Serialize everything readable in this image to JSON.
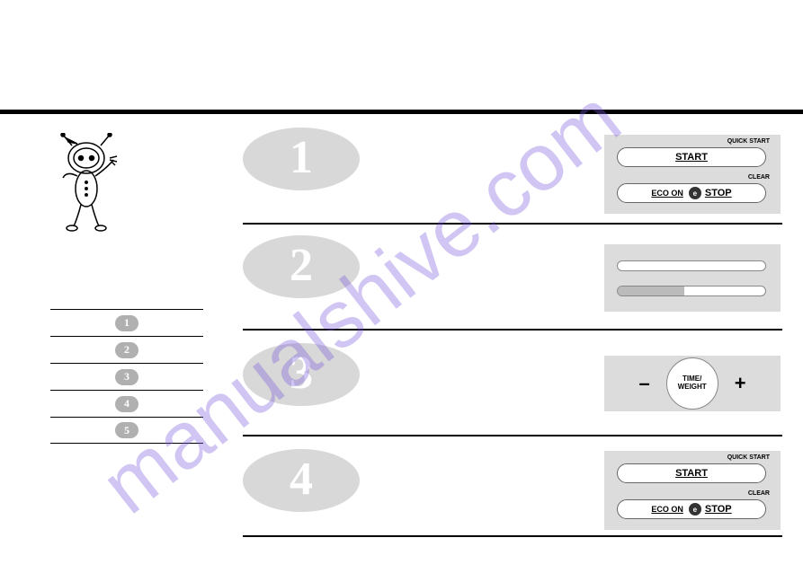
{
  "toc": {
    "items": [
      "1",
      "2",
      "3",
      "4",
      "5"
    ]
  },
  "steps": {
    "nums": [
      "1",
      "2",
      "3",
      "4"
    ]
  },
  "panel1": {
    "quick_label": "QUICK START",
    "start_label": "START",
    "clear_label": "CLEAR",
    "eco_label": "ECO ON",
    "eco_badge": "e",
    "stop_label": "STOP"
  },
  "panel3": {
    "minus": "–",
    "plus": "+",
    "tw_label": "TIME/\nWEIGHT"
  },
  "panel4": {
    "quick_label": "QUICK START",
    "start_label": "START",
    "clear_label": "CLEAR",
    "eco_label": "ECO ON",
    "eco_badge": "e",
    "stop_label": "STOP"
  },
  "watermark": "manualshive.com"
}
